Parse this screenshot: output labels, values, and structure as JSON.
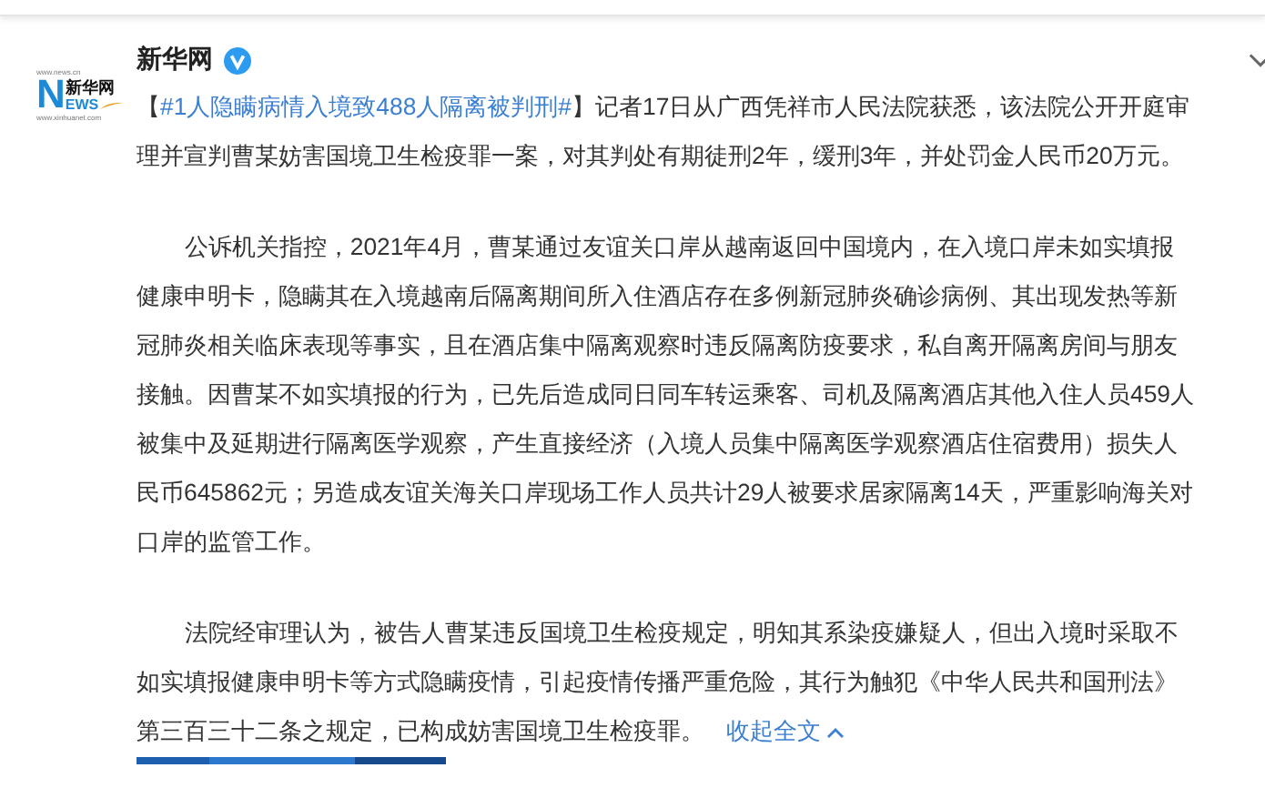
{
  "post": {
    "author": "新华网",
    "verified": true,
    "logo": {
      "url_top": "www.news.cn",
      "brand": "新华网",
      "big_letter": "N",
      "letters": "EWS",
      "url_bottom": "www.xinhuanet.com"
    },
    "paragraphs": [
      {
        "indent": false,
        "before": "【",
        "hashtag": "#1人隐瞒病情入境致488人隔离被判刑#",
        "text": "】记者17日从广西凭祥市人民法院获悉，该法院公开开庭审理并宣判曹某妨害国境卫生检疫罪一案，对其判处有期徒刑2年，缓刑3年，并处罚金人民币20万元。"
      },
      {
        "indent": true,
        "text": "公诉机关指控，2021年4月，曹某通过友谊关口岸从越南返回中国境内，在入境口岸未如实填报健康申明卡，隐瞒其在入境越南后隔离期间所入住酒店存在多例新冠肺炎确诊病例、其出现发热等新冠肺炎相关临床表现等事实，且在酒店集中隔离观察时违反隔离防疫要求，私自离开隔离房间与朋友接触。因曹某不如实填报的行为，已先后造成同日同车转运乘客、司机及隔离酒店其他入住人员459人被集中及延期进行隔离医学观察，产生直接经济（入境人员集中隔离医学观察酒店住宿费用）损失人民币645862元；另造成友谊关海关口岸现场工作人员共计29人被要求居家隔离14天，严重影响海关对口岸的监管工作。"
      },
      {
        "indent": true,
        "text": "法院经审理认为，被告人曹某违反国境卫生检疫规定，明知其系染疫嫌疑人，但出入境时采取不如实填报健康申明卡等方式隐瞒疫情，引起疫情传播严重危险，其行为触犯《中华人民共和国刑法》第三百三十二条之规定，已构成妨害国境卫生检疫罪。",
        "collapse_link": "收起全文"
      }
    ]
  }
}
